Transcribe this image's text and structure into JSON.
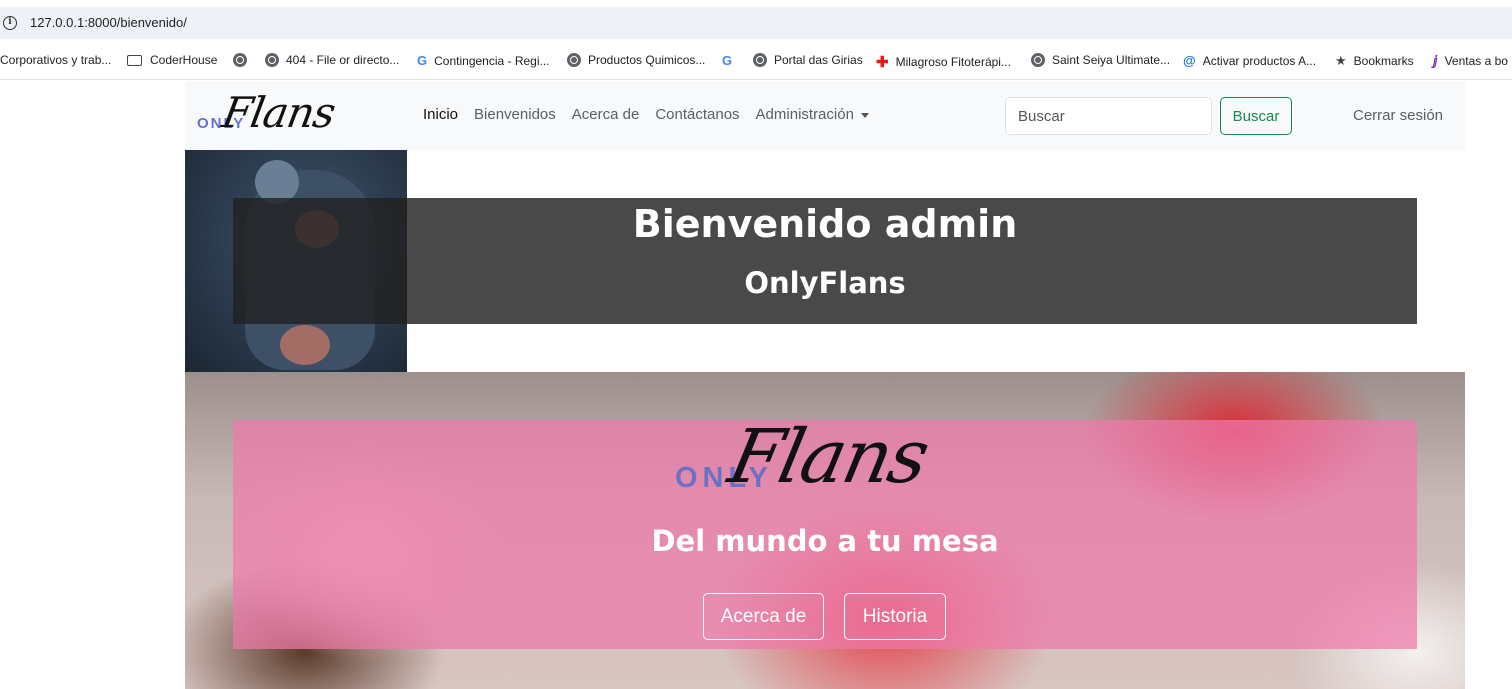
{
  "browser": {
    "url": "127.0.0.1:8000/bienvenido/",
    "bookmarks": [
      {
        "label": "Corporativos y trab...",
        "icon": "none"
      },
      {
        "label": "CoderHouse",
        "icon": "folder-icon"
      },
      {
        "label": "",
        "icon": "globe-icon"
      },
      {
        "label": "404 - File or directo...",
        "icon": "globe-icon"
      },
      {
        "label": "Contingencia - Regi...",
        "icon": "google-icon"
      },
      {
        "label": "Productos Quimicos...",
        "icon": "globe-icon"
      },
      {
        "label": "",
        "icon": "google-icon"
      },
      {
        "label": "Portal das Girias",
        "icon": "globe-icon"
      },
      {
        "label": "Milagroso Fitoterápi...",
        "icon": "red-cross-icon"
      },
      {
        "label": "Saint Seiya Ultimate...",
        "icon": "globe-icon"
      },
      {
        "label": "Activar productos A...",
        "icon": "app-icon"
      },
      {
        "label": "Bookmarks",
        "icon": "star-icon"
      },
      {
        "label": "Ventas a bo",
        "icon": "purple-icon"
      }
    ]
  },
  "navbar": {
    "brand_only": "ONLY",
    "brand_flans": "Flans",
    "links": [
      "Inicio",
      "Bienvenidos",
      "Acerca de",
      "Contáctanos",
      "Administración"
    ],
    "search_placeholder": "Buscar",
    "search_button": "Buscar",
    "logout": "Cerrar sesión"
  },
  "welcome": {
    "title": "Bienvenido admin",
    "subtitle": "OnlyFlans"
  },
  "hero": {
    "logo_only": "ONLY",
    "logo_flans": "Flans",
    "tagline": "Del mundo a tu mesa",
    "button_about": "Acerca de",
    "button_history": "Historia"
  },
  "colors": {
    "success": "#198754",
    "brand_blue": "#6b72c4",
    "hero_overlay": "#ee78aa"
  }
}
